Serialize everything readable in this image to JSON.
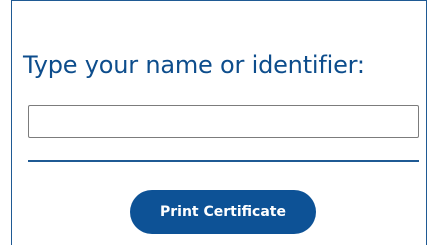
{
  "form": {
    "prompt_label": "Type your name or identifier:",
    "name_value": "",
    "name_placeholder": "",
    "print_button_label": "Print Certificate"
  },
  "colors": {
    "accent": "#0d5296",
    "heading": "#0d4d8c",
    "border": "#1f5a94"
  }
}
